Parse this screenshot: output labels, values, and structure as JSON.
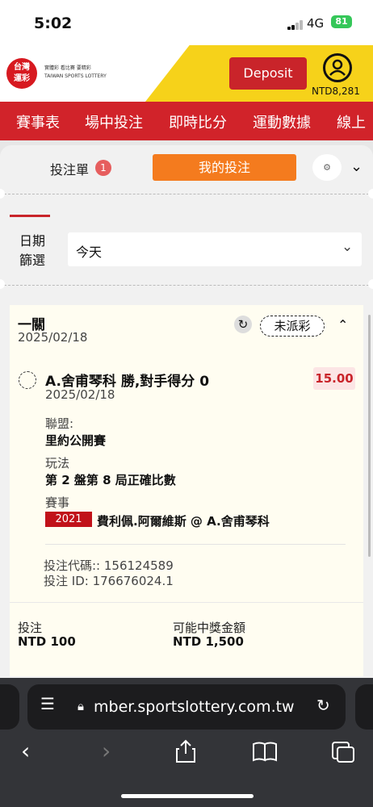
{
  "status_bar": {
    "time": "5:02",
    "network": "4G",
    "battery": "81"
  },
  "header": {
    "logo_line1": "台灣",
    "logo_line2": "運彩",
    "logo_tagline": "實體彩 看比賽 要精彩",
    "logo_sub": "TAIWAN SPORTS LOTTERY",
    "deposit_label": "Deposit",
    "balance": "NTD8,281"
  },
  "nav": {
    "items": [
      "賽事表",
      "場中投注",
      "即時比分",
      "運動數據",
      "線上"
    ]
  },
  "bet_tabs": {
    "slip_label": "投注單",
    "slip_count": "1",
    "my_bets_label": "我的投注"
  },
  "filter": {
    "date_label": "日期\n篩選",
    "date_value": "今天"
  },
  "bet": {
    "type": "一關",
    "date": "2025/02/18",
    "status": "未派彩",
    "selection": "A.舍甫琴科 勝,對手得分 0",
    "selection_date": "2025/02/18",
    "odds": "15.00",
    "league_label": "聯盟:",
    "league": "里約公開賽",
    "market_label": "玩法",
    "market": "第 2 盤第 8 局正確比數",
    "event_label": "賽事",
    "event_year": "2021",
    "event": "費利佩.阿爾維斯 @ A.舍甫琴科",
    "code_line": "投注代碼:: 156124589",
    "id_line": "投注 ID: 176676024.1",
    "stake_label": "投注",
    "stake": "NTD 100",
    "payout_label": "可能中獎金額",
    "payout": "NTD 1,500"
  },
  "browser": {
    "url": "mber.sportslottery.com.tw"
  },
  "icons": [
    "account-icon",
    "settings-icon",
    "chevron-down-icon",
    "refresh-icon",
    "chevron-up-icon",
    "lock-icon",
    "reload-icon",
    "back-icon",
    "forward-icon",
    "share-icon",
    "bookmarks-icon",
    "tabs-icon"
  ],
  "colors": {
    "brand_red": "#d1232a",
    "accent_orange": "#f47b1e",
    "header_yellow": "#f6d21a"
  }
}
